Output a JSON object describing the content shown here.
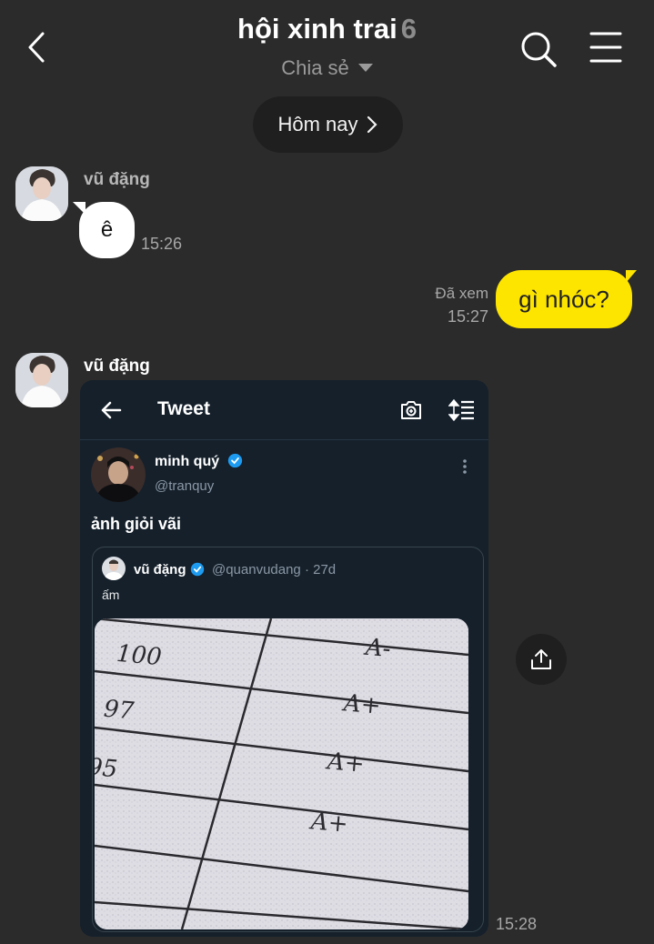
{
  "header": {
    "title": "hội xinh trai",
    "member_count": "6",
    "subtitle": "Chia sẻ",
    "date_pill": "Hôm nay"
  },
  "messages": [
    {
      "sender": "vũ đặng",
      "text": "ê",
      "time": "15:26"
    },
    {
      "status": "Đã xem",
      "text": "gì nhóc?",
      "time": "15:27"
    },
    {
      "sender": "vũ đặng",
      "time": "15:28"
    }
  ],
  "tweet": {
    "title": "Tweet",
    "author_name": "minh quý",
    "author_handle": "@tranquy",
    "text": "ảnh giỏi vãi",
    "quote": {
      "author_name": "vũ đặng",
      "author_handle": "@quanvudang · 27d",
      "text": "ấm",
      "image_rows": [
        {
          "score": "100",
          "grade": "A-"
        },
        {
          "score": "97",
          "grade": "A+"
        },
        {
          "score": "95",
          "grade": "A+"
        },
        {
          "score": "",
          "grade": "A+"
        }
      ]
    }
  },
  "colors": {
    "background": "#2b2b2b",
    "my_bubble": "#fee500",
    "their_bubble": "#ffffff",
    "tweet_bg": "#15202b",
    "verified": "#1d9bf0"
  }
}
